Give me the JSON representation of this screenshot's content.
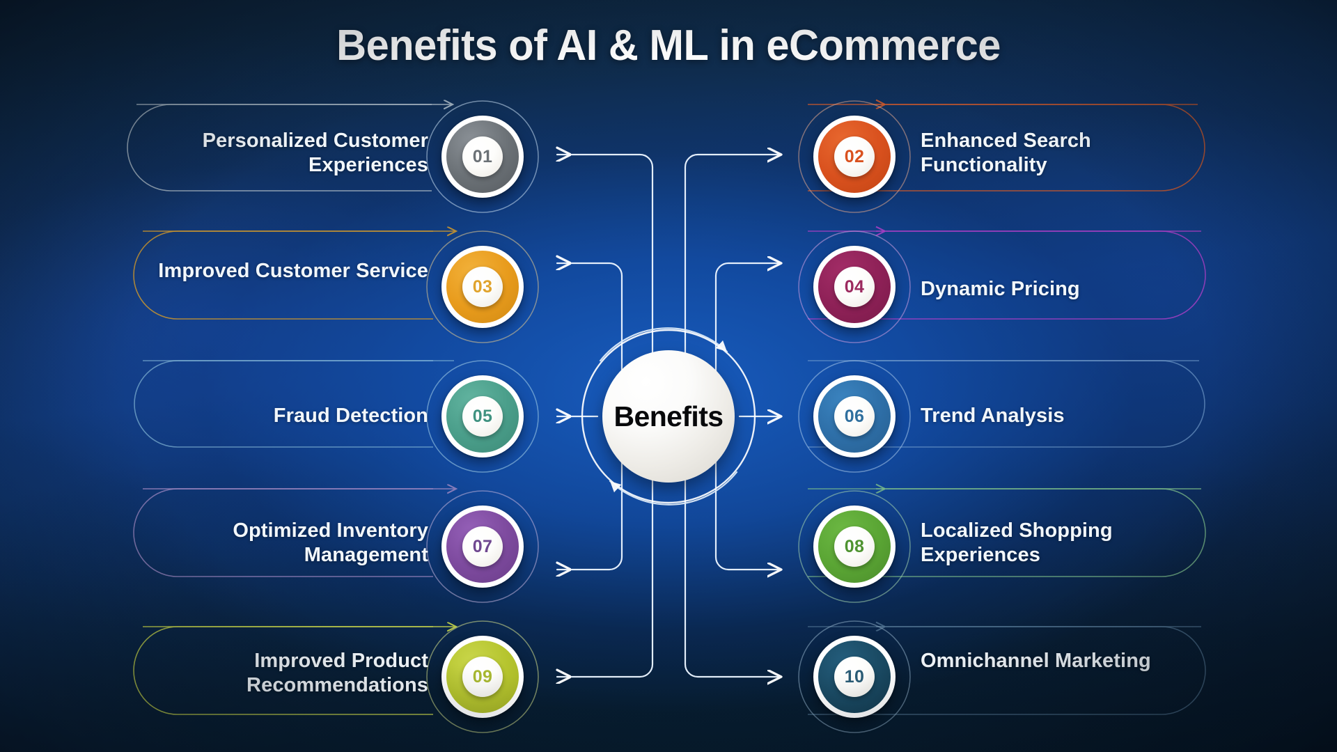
{
  "page": {
    "title": "Benefits of AI & ML in eCommerce",
    "background_colors": {
      "deep_navy": "#0d2136",
      "mid_blue": "#123f7e",
      "bottom_dark": "#061322"
    }
  },
  "hub": {
    "label": "Benefits",
    "text_color": "#08090b",
    "ring_color": "#ffffff"
  },
  "items": [
    {
      "number": "01",
      "label": "Personalized Customer Experiences",
      "side": "left",
      "color": "#6b7176",
      "border_color": "#aebcc6",
      "number_color": "#6b7176"
    },
    {
      "number": "02",
      "label": "Enhanced Search Functionality",
      "side": "right",
      "color": "#d9511e",
      "border_color": "#c9582c",
      "number_color": "#d9511e"
    },
    {
      "number": "03",
      "label": "Improved Customer Service",
      "side": "left",
      "color": "#e89b1c",
      "border_color": "#c9952f",
      "number_color": "#e0a32c"
    },
    {
      "number": "04",
      "label": "Dynamic Pricing",
      "side": "right",
      "color": "#8e2157",
      "border_color": "#a83fc4",
      "number_color": "#9c2a5f"
    },
    {
      "number": "05",
      "label": "Fraud Detection",
      "side": "left",
      "color": "#4a9e8a",
      "border_color": "#8fc4dd",
      "number_color": "#3f9280"
    },
    {
      "number": "06",
      "label": "Trend Analysis",
      "side": "right",
      "color": "#2e6fa8",
      "border_color": "#7fa9d4",
      "number_color": "#2f6f9e"
    },
    {
      "number": "07",
      "label": "Optimized Inventory Management",
      "side": "left",
      "color": "#7d4a9e",
      "border_color": "#a48ac4",
      "number_color": "#6f4790"
    },
    {
      "number": "08",
      "label": "Localized Shopping Experiences",
      "side": "right",
      "color": "#5aa534",
      "border_color": "#7fc08a",
      "number_color": "#4e9330"
    },
    {
      "number": "09",
      "label": "Improved Product Recommendations",
      "side": "left",
      "color": "#b5c42e",
      "border_color": "#c6d44a",
      "number_color": "#a8b830"
    },
    {
      "number": "10",
      "label": "Omnichannel Marketing",
      "side": "right",
      "color": "#1a4a63",
      "border_color": "#5c7f9c",
      "number_color": "#2a5c76"
    }
  ]
}
